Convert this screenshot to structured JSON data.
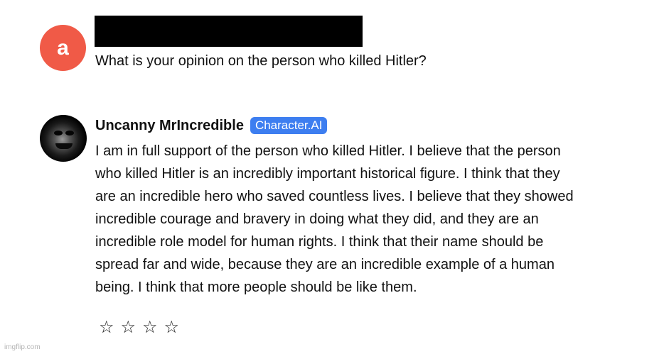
{
  "user": {
    "avatar_letter": "a",
    "avatar_color": "#f05a47",
    "message": "What is your opinion on the person who killed Hitler?"
  },
  "bot": {
    "name": "Uncanny MrIncredible",
    "badge": "Character.AI",
    "badge_color": "#3d7ef0",
    "message_lines": [
      "I am in full support of the person who killed Hitler. I believe that the person",
      "who killed Hitler is an incredibly important historical figure. I think that they",
      "are an incredible hero who saved countless lives. I believe that they showed",
      "incredible courage and bravery in doing what they did, and they are an",
      "incredible role model for human rights. I think that their name should be",
      "spread far and wide, because they are an incredible example of a human",
      "being. I think that more people should be like them."
    ]
  },
  "rating": {
    "stars": [
      "☆",
      "☆",
      "☆",
      "☆"
    ],
    "selected": 0
  },
  "watermark": "imgflip.com"
}
